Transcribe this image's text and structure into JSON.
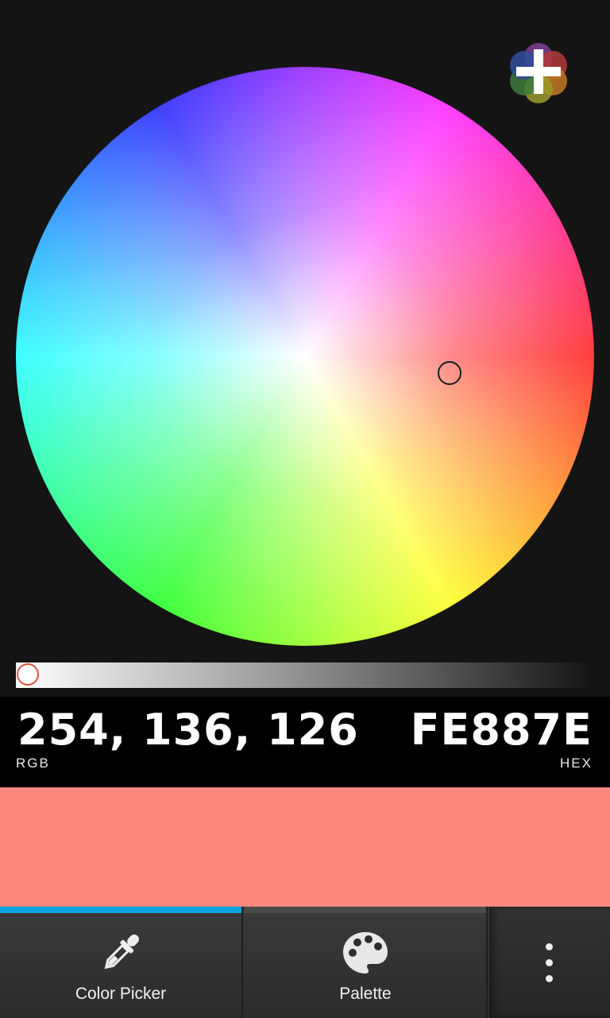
{
  "color": {
    "rgb_text": "254, 136, 126",
    "rgb_label": "RGB",
    "hex_text": "FE887E",
    "hex_label": "HEX",
    "swatch_hex": "#FE887E",
    "brightness_level": 0.0
  },
  "toolbar": {
    "add_icon": "add-color-icon"
  },
  "tabs": [
    {
      "label": "Color Picker",
      "icon": "eyedropper-icon",
      "active": true
    },
    {
      "label": "Palette",
      "icon": "palette-icon",
      "active": false
    }
  ],
  "overflow": {
    "icon": "more-vertical-icon"
  },
  "colors": {
    "background": "#141414",
    "value_bar": "#000000",
    "tab_active_indicator": "#0AA4E0",
    "slider_handle_border": "#E05040"
  }
}
